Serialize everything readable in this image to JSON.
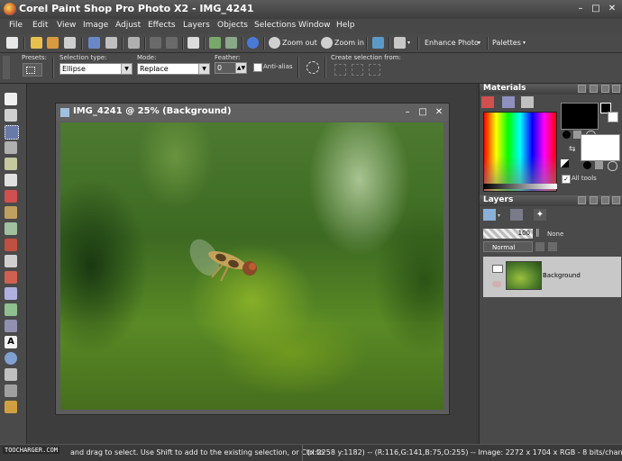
{
  "window": {
    "title": "Corel Paint Shop Pro Photo X2 - IMG_4241",
    "minimize": "–",
    "maximize": "□",
    "close": "✕"
  },
  "menu": [
    "File",
    "Edit",
    "View",
    "Image",
    "Adjust",
    "Effects",
    "Layers",
    "Objects",
    "Selections",
    "Window",
    "Help"
  ],
  "toolbar": {
    "zoom_out": "Zoom out",
    "zoom_in": "Zoom in",
    "enhance_photo": "Enhance Photo",
    "palettes": "Palettes",
    "dropdown_arrow": "▾"
  },
  "tool_options": {
    "presets_label": "Presets:",
    "selection_type_label": "Selection type:",
    "selection_type_value": "Ellipse",
    "mode_label": "Mode:",
    "mode_value": "Replace",
    "feather_label": "Feather:",
    "feather_value": "0",
    "anti_alias_label": "Anti-alias",
    "create_selection_label": "Create selection from:"
  },
  "document": {
    "title": "IMG_4241 @  25% (Background)"
  },
  "materials": {
    "title": "Materials",
    "all_tools_label": "All tools"
  },
  "layers": {
    "title": "Layers",
    "opacity": "100",
    "blend_mode": "Normal",
    "mask_label": "None",
    "layer_name": "Background"
  },
  "status": {
    "watermark": "TOOCHARGER.COM",
    "hint": "and drag to select. Use Shift to add to the existing selection, or Ctrl to",
    "info": "(x:2258 y:1182) -- (R:116,G:141,B:75,O:255) -- Image:  2272 x 1704 x RGB - 8 bits/channel"
  },
  "colors": {
    "chrome": "#4a4a4a",
    "workspace": "#3d3d3d",
    "foreground_swatch": "#000000",
    "background_swatch": "#ffffff",
    "layer_selected": "#c8c8c8"
  }
}
